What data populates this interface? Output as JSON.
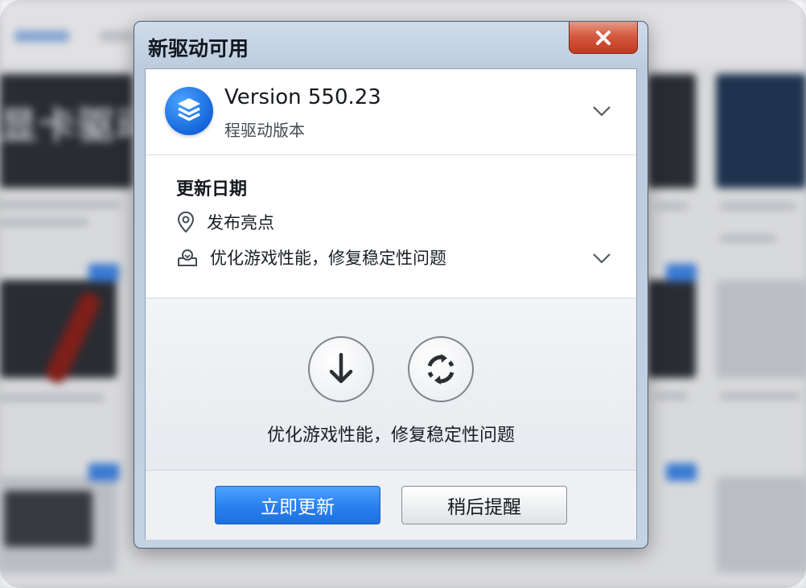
{
  "dialog": {
    "title": "新驱动可用",
    "close_icon": "close-icon",
    "accent_color": "#2a82f0",
    "close_color": "#d45a41"
  },
  "driver": {
    "version": "Version 550.23",
    "subtitle": "程驱动版本",
    "icon": "layers-icon"
  },
  "info": {
    "heading": "更新日期",
    "release_label": "发布亮点",
    "release_icon": "location-pin-icon",
    "detail": "优化游戏性能，修复稳定性问题",
    "detail_icon": "install-icon"
  },
  "actions": {
    "download_icon": "download-arrow-icon",
    "refresh_icon": "refresh-icon",
    "description": "优化游戏性能，修复稳定性问题"
  },
  "footer": {
    "update_label": "立即更新",
    "later_label": "稍后提醒"
  },
  "background": {
    "headline": "显卡驱动"
  }
}
